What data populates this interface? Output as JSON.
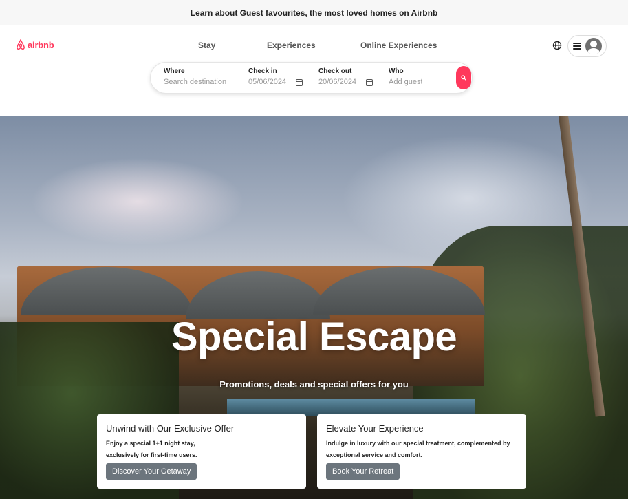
{
  "banner": {
    "link_text": "Learn about Guest favourites, the most loved homes on Airbnb"
  },
  "header": {
    "logo_text": "airbnb",
    "nav": {
      "stay": "Stay",
      "experiences": "Experiences",
      "online_experiences": "Online Experiences"
    },
    "icons": {
      "globe": "globe-icon",
      "menu": "hamburger-icon",
      "avatar": "user-avatar-icon"
    }
  },
  "search": {
    "where": {
      "label": "Where",
      "placeholder": "Search destination"
    },
    "check_in": {
      "label": "Check in",
      "value": "05/06/2024"
    },
    "check_out": {
      "label": "Check out",
      "value": "20/06/2024"
    },
    "who": {
      "label": "Who",
      "placeholder": "Add guests"
    }
  },
  "hero": {
    "title": "Special Escape",
    "subtitle": "Promotions, deals and special offers for you"
  },
  "cards": [
    {
      "title": "Unwind with Our Exclusive Offer",
      "text_line1": "Enjoy a special 1+1 night stay,",
      "text_line2": "exclusively for first-time users.",
      "button": "Discover Your Getaway"
    },
    {
      "title": "Elevate Your Experience",
      "text_line1": "Indulge in luxury with our special treatment, complemented by",
      "text_line2": "exceptional service and comfort.",
      "button": "Book Your Retreat"
    }
  ],
  "colors": {
    "brand": "#ff385c",
    "button_gray": "#6c757d",
    "banner_bg": "#f7f7f7"
  }
}
